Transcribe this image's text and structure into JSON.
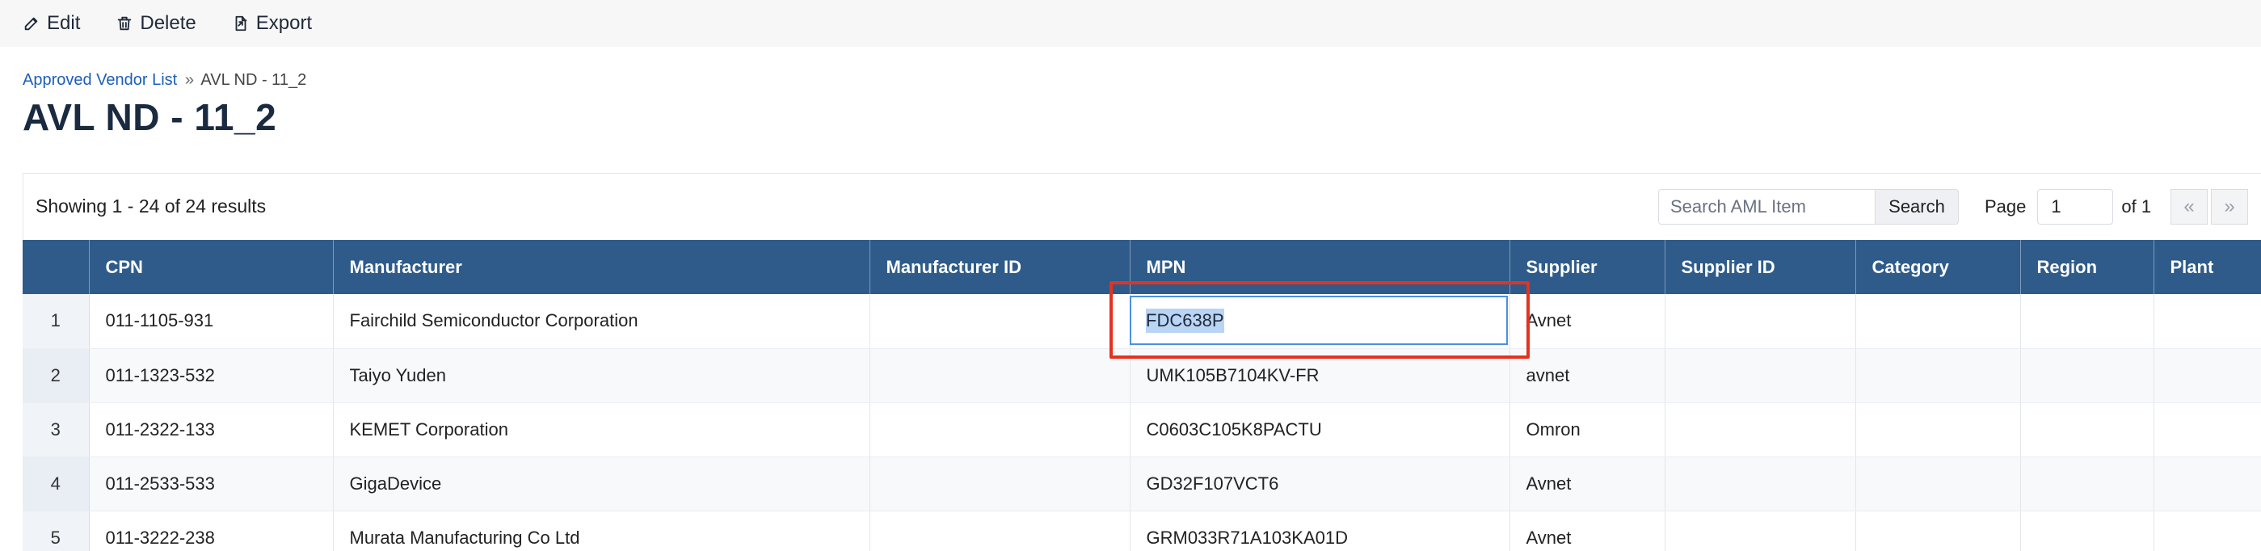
{
  "toolbar": {
    "edit_label": "Edit",
    "delete_label": "Delete",
    "export_label": "Export"
  },
  "breadcrumb": {
    "parent": "Approved Vendor List",
    "separator": "»",
    "current": "AVL ND - 11_2"
  },
  "page_title": "AVL ND - 11_2",
  "results": {
    "summary": "Showing 1 - 24 of 24 results"
  },
  "search": {
    "placeholder": "Search AML Item",
    "button_label": "Search"
  },
  "pagination": {
    "page_label": "Page",
    "current_page": "1",
    "of_label": "of 1",
    "first_label": "«",
    "prev_label": "»"
  },
  "table": {
    "headers": [
      "",
      "CPN",
      "Manufacturer",
      "Manufacturer ID",
      "MPN",
      "Supplier",
      "Supplier ID",
      "Category",
      "Region",
      "Plant"
    ],
    "rows": [
      [
        "1",
        "011-1105-931",
        "Fairchild Semiconductor Corporation",
        "",
        "FDC638P",
        "Avnet",
        "",
        "",
        "",
        ""
      ],
      [
        "2",
        "011-1323-532",
        "Taiyo Yuden",
        "",
        "UMK105B7104KV-FR",
        "avnet",
        "",
        "",
        "",
        ""
      ],
      [
        "3",
        "011-2322-133",
        "KEMET Corporation",
        "",
        "C0603C105K8PACTU",
        "Omron",
        "",
        "",
        "",
        ""
      ],
      [
        "4",
        "011-2533-533",
        "GigaDevice",
        "",
        "GD32F107VCT6",
        "Avnet",
        "",
        "",
        "",
        ""
      ],
      [
        "5",
        "011-3222-238",
        "Murata Manufacturing Co Ltd",
        "",
        "GRM033R71A103KA01D",
        "Avnet",
        "",
        "",
        "",
        ""
      ]
    ]
  },
  "editing_cell": {
    "value": "FDC638P"
  },
  "colors": {
    "header_bg": "#2e5b8a",
    "highlight": "#e5321f",
    "link": "#1c5fb8"
  }
}
